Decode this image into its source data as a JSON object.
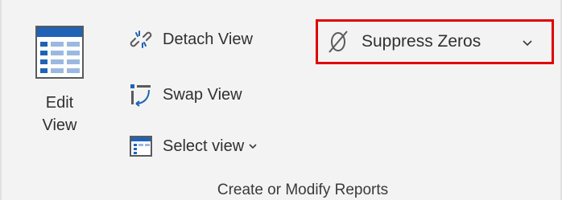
{
  "ribbon": {
    "edit_view": {
      "line1": "Edit",
      "line2": "View",
      "icon": "table-view-icon"
    },
    "commands": {
      "detach": {
        "label": "Detach View",
        "icon": "detach-link-icon"
      },
      "swap": {
        "label": "Swap View",
        "icon": "swap-view-icon"
      },
      "select": {
        "label": "Select view",
        "icon": "select-view-icon"
      }
    },
    "suppress_zeros": {
      "label": "Suppress Zeros",
      "icon": "empty-set-icon",
      "highlighted": true,
      "highlight_color": "#e00000"
    },
    "group_title": "Create or Modify Reports"
  },
  "colors": {
    "icon_blue": "#1e63b6",
    "background": "#f3f3f3",
    "text": "#303030"
  }
}
